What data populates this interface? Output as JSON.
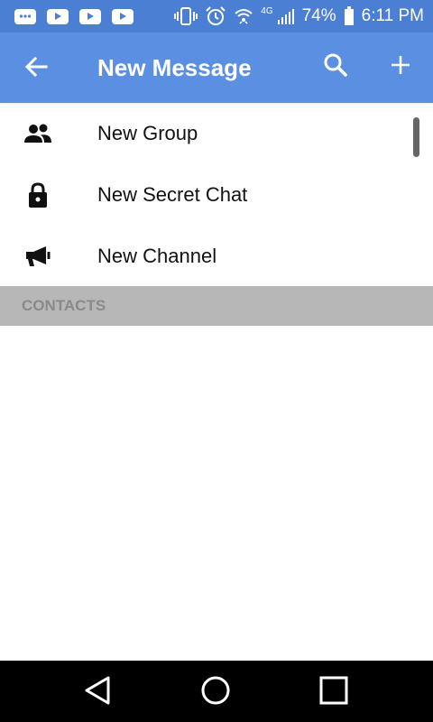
{
  "status_bar": {
    "notifications": [
      "chat-notification-icon",
      "youtube-icon",
      "youtube-icon",
      "youtube-icon"
    ],
    "network_label": "4G",
    "battery_percent": "74%",
    "time": "6:11 PM",
    "bg_color": "#4a7fd3"
  },
  "app_bar": {
    "title": "New Message",
    "bg_color": "#5b8fe2",
    "back_icon": "arrow-back-icon",
    "search_icon": "search-icon",
    "add_icon": "plus-icon"
  },
  "menu": {
    "items": [
      {
        "label": "New Group",
        "icon": "group-icon"
      },
      {
        "label": "New Secret Chat",
        "icon": "lock-icon"
      },
      {
        "label": "New Channel",
        "icon": "megaphone-icon"
      }
    ]
  },
  "contacts_section": {
    "header": "CONTACTS"
  },
  "nav_bar": {
    "back": "triangle-back-icon",
    "home": "circle-home-icon",
    "recents": "square-recents-icon"
  }
}
